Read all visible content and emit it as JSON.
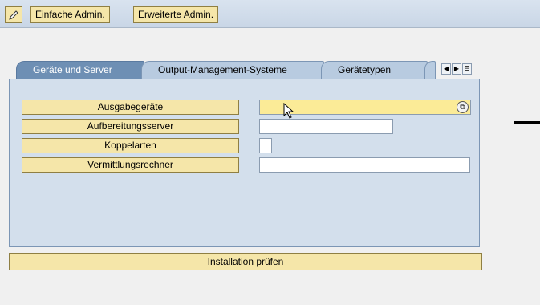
{
  "toolbar": {
    "edit_icon": "pencil-icon",
    "buttons": [
      "Einfache Admin.",
      "Erweiterte Admin."
    ]
  },
  "tabs": [
    {
      "label": "Geräte und Server",
      "active": true
    },
    {
      "label": "Output-Management-Systeme",
      "active": false
    },
    {
      "label": "Gerätetypen",
      "active": false
    }
  ],
  "fields": [
    {
      "label": "Ausgabegeräte",
      "value": ""
    },
    {
      "label": "Aufbereitungsserver",
      "value": ""
    },
    {
      "label": "Koppelarten",
      "value": ""
    },
    {
      "label": "Vermittlungsrechner",
      "value": ""
    }
  ],
  "install_button": "Installation prüfen",
  "colors": {
    "button_bg": "#f5e6a9",
    "panel_bg": "#d3dfec",
    "active_tab": "#6e8fb4",
    "highlight_input": "#fbeb97"
  }
}
